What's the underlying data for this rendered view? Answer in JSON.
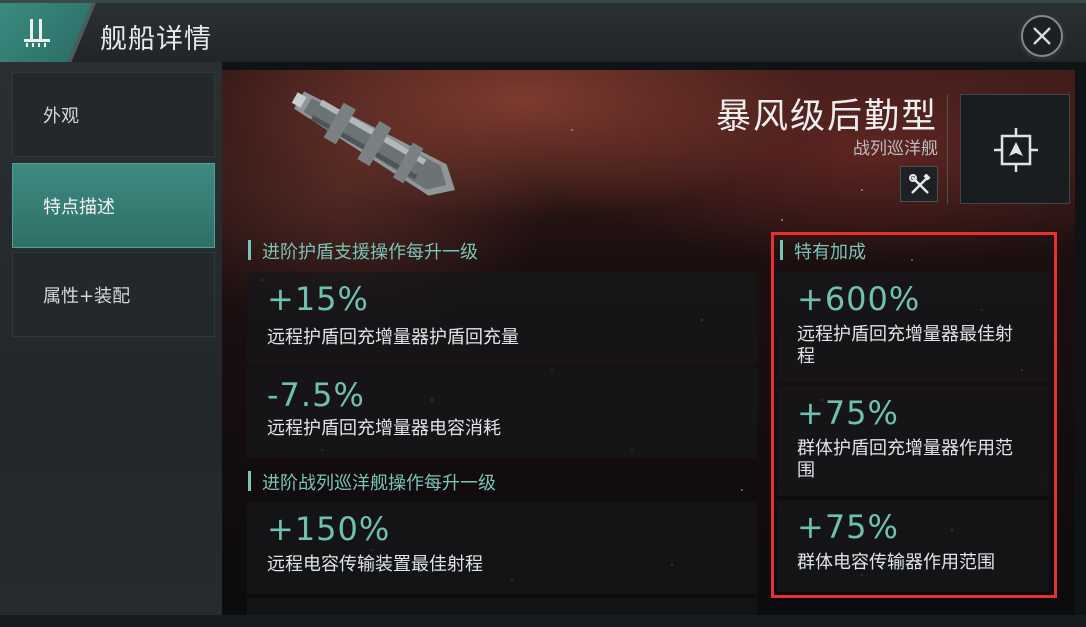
{
  "header": {
    "title": "舰船详情"
  },
  "sidebar": {
    "items": [
      {
        "label": "外观"
      },
      {
        "label": "特点描述"
      },
      {
        "label": "属性+装配"
      }
    ]
  },
  "ship": {
    "name": "暴风级后勤型",
    "class": "战列巡洋舰"
  },
  "sections": [
    {
      "title": "进阶护盾支援操作每升一级",
      "bonuses": [
        {
          "value": "+15%",
          "desc": "远程护盾回充增量器护盾回充量"
        },
        {
          "value": "-7.5%",
          "desc": "远程护盾回充增量器电容消耗"
        }
      ]
    },
    {
      "title": "进阶战列巡洋舰操作每升一级",
      "bonuses": [
        {
          "value": "+150%",
          "desc": "远程电容传输装置最佳射程"
        }
      ]
    }
  ],
  "role_bonus": {
    "title": "特有加成",
    "bonuses": [
      {
        "value": "+600%",
        "desc_line1": "远程护盾回充增量器最佳射",
        "desc_line2": "程"
      },
      {
        "value": "+75%",
        "desc_line1": "群体护盾回充增量器作用范",
        "desc_line2": "围"
      },
      {
        "value": "+75%",
        "desc_line1": "群体电容传输器作用范围",
        "desc_line2": ""
      }
    ]
  },
  "colors": {
    "accent": "#6fc0b1",
    "highlight_border": "#e8312f",
    "active_tab": "#3e8a80"
  },
  "icons": {
    "logo": "ship-logo-icon",
    "close": "close-icon",
    "tools": "tools-icon",
    "target": "target-icon"
  }
}
